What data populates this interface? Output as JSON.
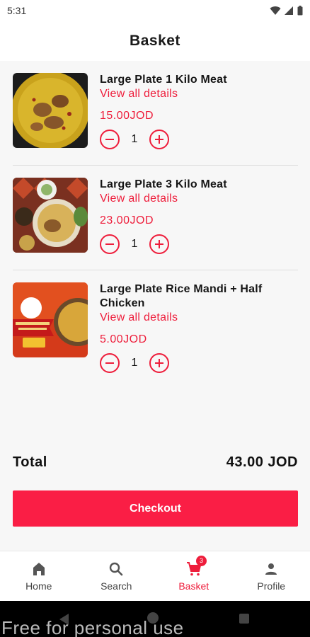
{
  "status_bar": {
    "time": "5:31"
  },
  "header": {
    "title": "Basket"
  },
  "items": [
    {
      "name": "Large Plate 1 Kilo Meat",
      "details_label": "View all details",
      "price": "15.00JOD",
      "quantity": "1"
    },
    {
      "name": "Large Plate 3 Kilo Meat",
      "details_label": "View all details",
      "price": "23.00JOD",
      "quantity": "1"
    },
    {
      "name": "Large Plate Rice Mandi + Half Chicken",
      "details_label": "View all details",
      "price": "5.00JOD",
      "quantity": "1"
    }
  ],
  "summary": {
    "total_label": "Total",
    "total_value": "43.00 JOD"
  },
  "checkout": {
    "label": "Checkout"
  },
  "nav": {
    "items": [
      {
        "label": "Home",
        "icon": "home-icon"
      },
      {
        "label": "Search",
        "icon": "search-icon"
      },
      {
        "label": "Basket",
        "icon": "cart-icon",
        "badge": "3",
        "active": true
      },
      {
        "label": "Profile",
        "icon": "person-icon"
      }
    ]
  },
  "colors": {
    "accent": "#ee1d3b",
    "checkout": "#fa1e45"
  },
  "watermark": {
    "text": "Free for personal use"
  }
}
